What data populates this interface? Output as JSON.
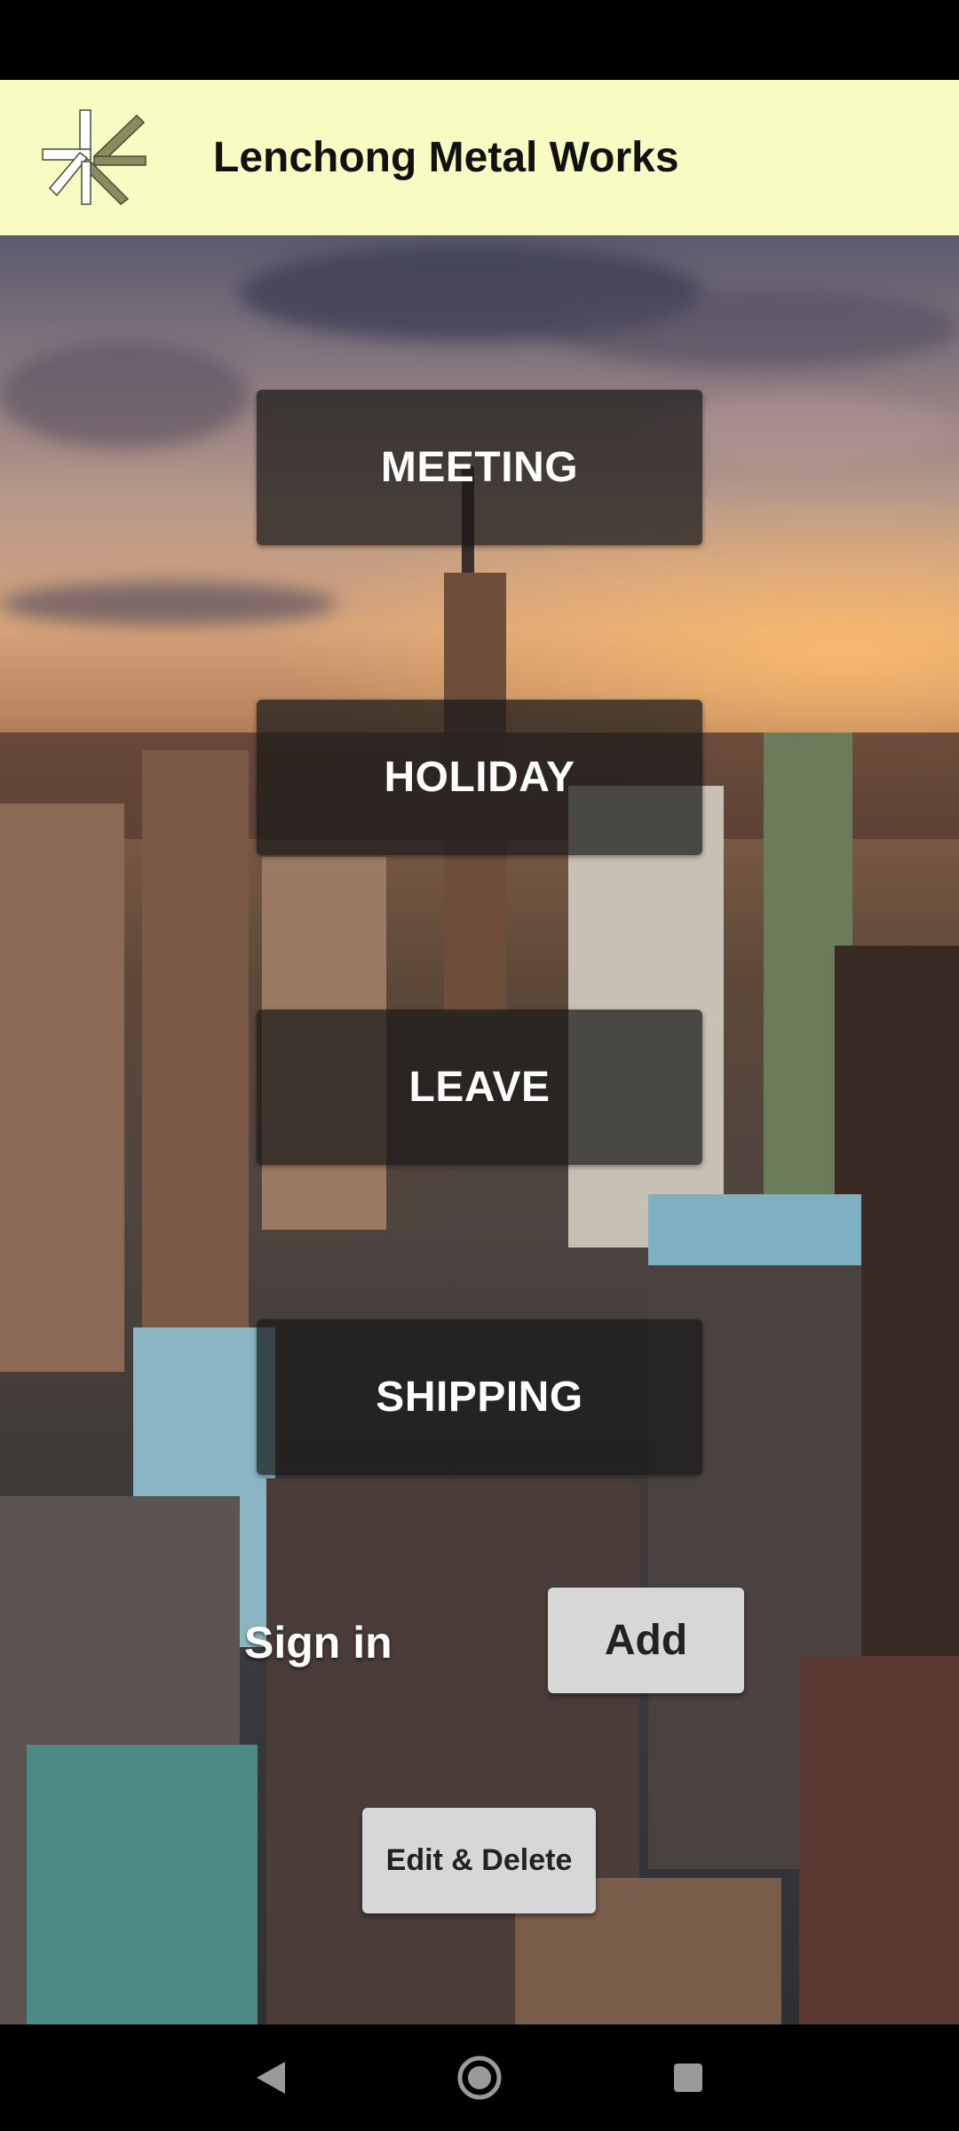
{
  "app_bar": {
    "title": "Lenchong Metal Works",
    "logo_icon": "star-burst-logo-icon",
    "background": "#f7fcc2"
  },
  "menu": {
    "buttons": [
      {
        "label": "MEETING"
      },
      {
        "label": "HOLIDAY"
      },
      {
        "label": "LEAVE"
      },
      {
        "label": "SHIPPING"
      }
    ]
  },
  "actions": {
    "sign_in_label": "Sign in",
    "add_label": "Add",
    "edit_delete_label": "Edit & Delete"
  },
  "nav_bar": {
    "back_icon": "back-triangle-icon",
    "home_icon": "home-circle-icon",
    "recents_icon": "recents-square-icon"
  }
}
